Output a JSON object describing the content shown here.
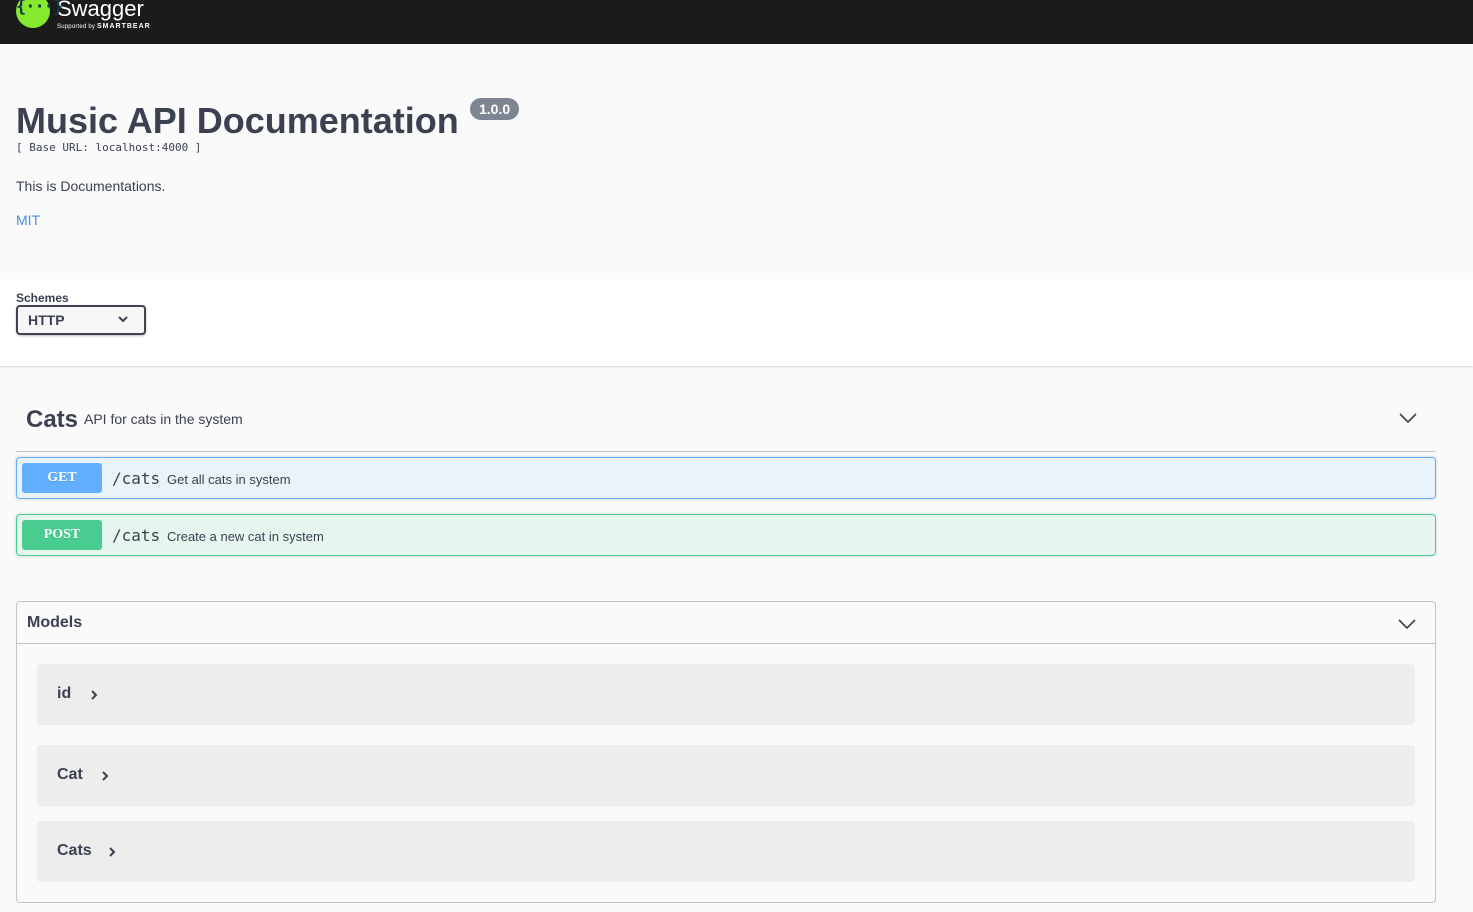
{
  "topbar": {
    "logo_glyph": "{···}",
    "logo_name": "Swagger",
    "logo_sub_prefix": "Supported by",
    "logo_sub_brand": "SMARTBEAR",
    "brand_color": "#85ea2d"
  },
  "info": {
    "title": "Music API Documentation",
    "version": "1.0.0",
    "base_url": "[ Base URL: localhost:4000 ]",
    "description": "This is Documentations.",
    "license": "MIT"
  },
  "schemes": {
    "label": "Schemes",
    "selected": "HTTP",
    "icon": "chevron-down-icon"
  },
  "tags": [
    {
      "name": "Cats",
      "description": "API for cats in the system",
      "expanded": true,
      "icon": "chevron-down-icon",
      "operations": [
        {
          "method": "GET",
          "path": "/cats",
          "summary": "Get all cats in system",
          "color": "#61affe"
        },
        {
          "method": "POST",
          "path": "/cats",
          "summary": "Create a new cat in system",
          "color": "#49cc90"
        }
      ]
    }
  ],
  "models": {
    "title": "Models",
    "icon": "chevron-down-icon",
    "items": [
      {
        "name": "id",
        "icon": "chevron-right-icon"
      },
      {
        "name": "Cat",
        "icon": "chevron-right-icon"
      },
      {
        "name": "Cats",
        "icon": "chevron-right-icon"
      }
    ]
  }
}
